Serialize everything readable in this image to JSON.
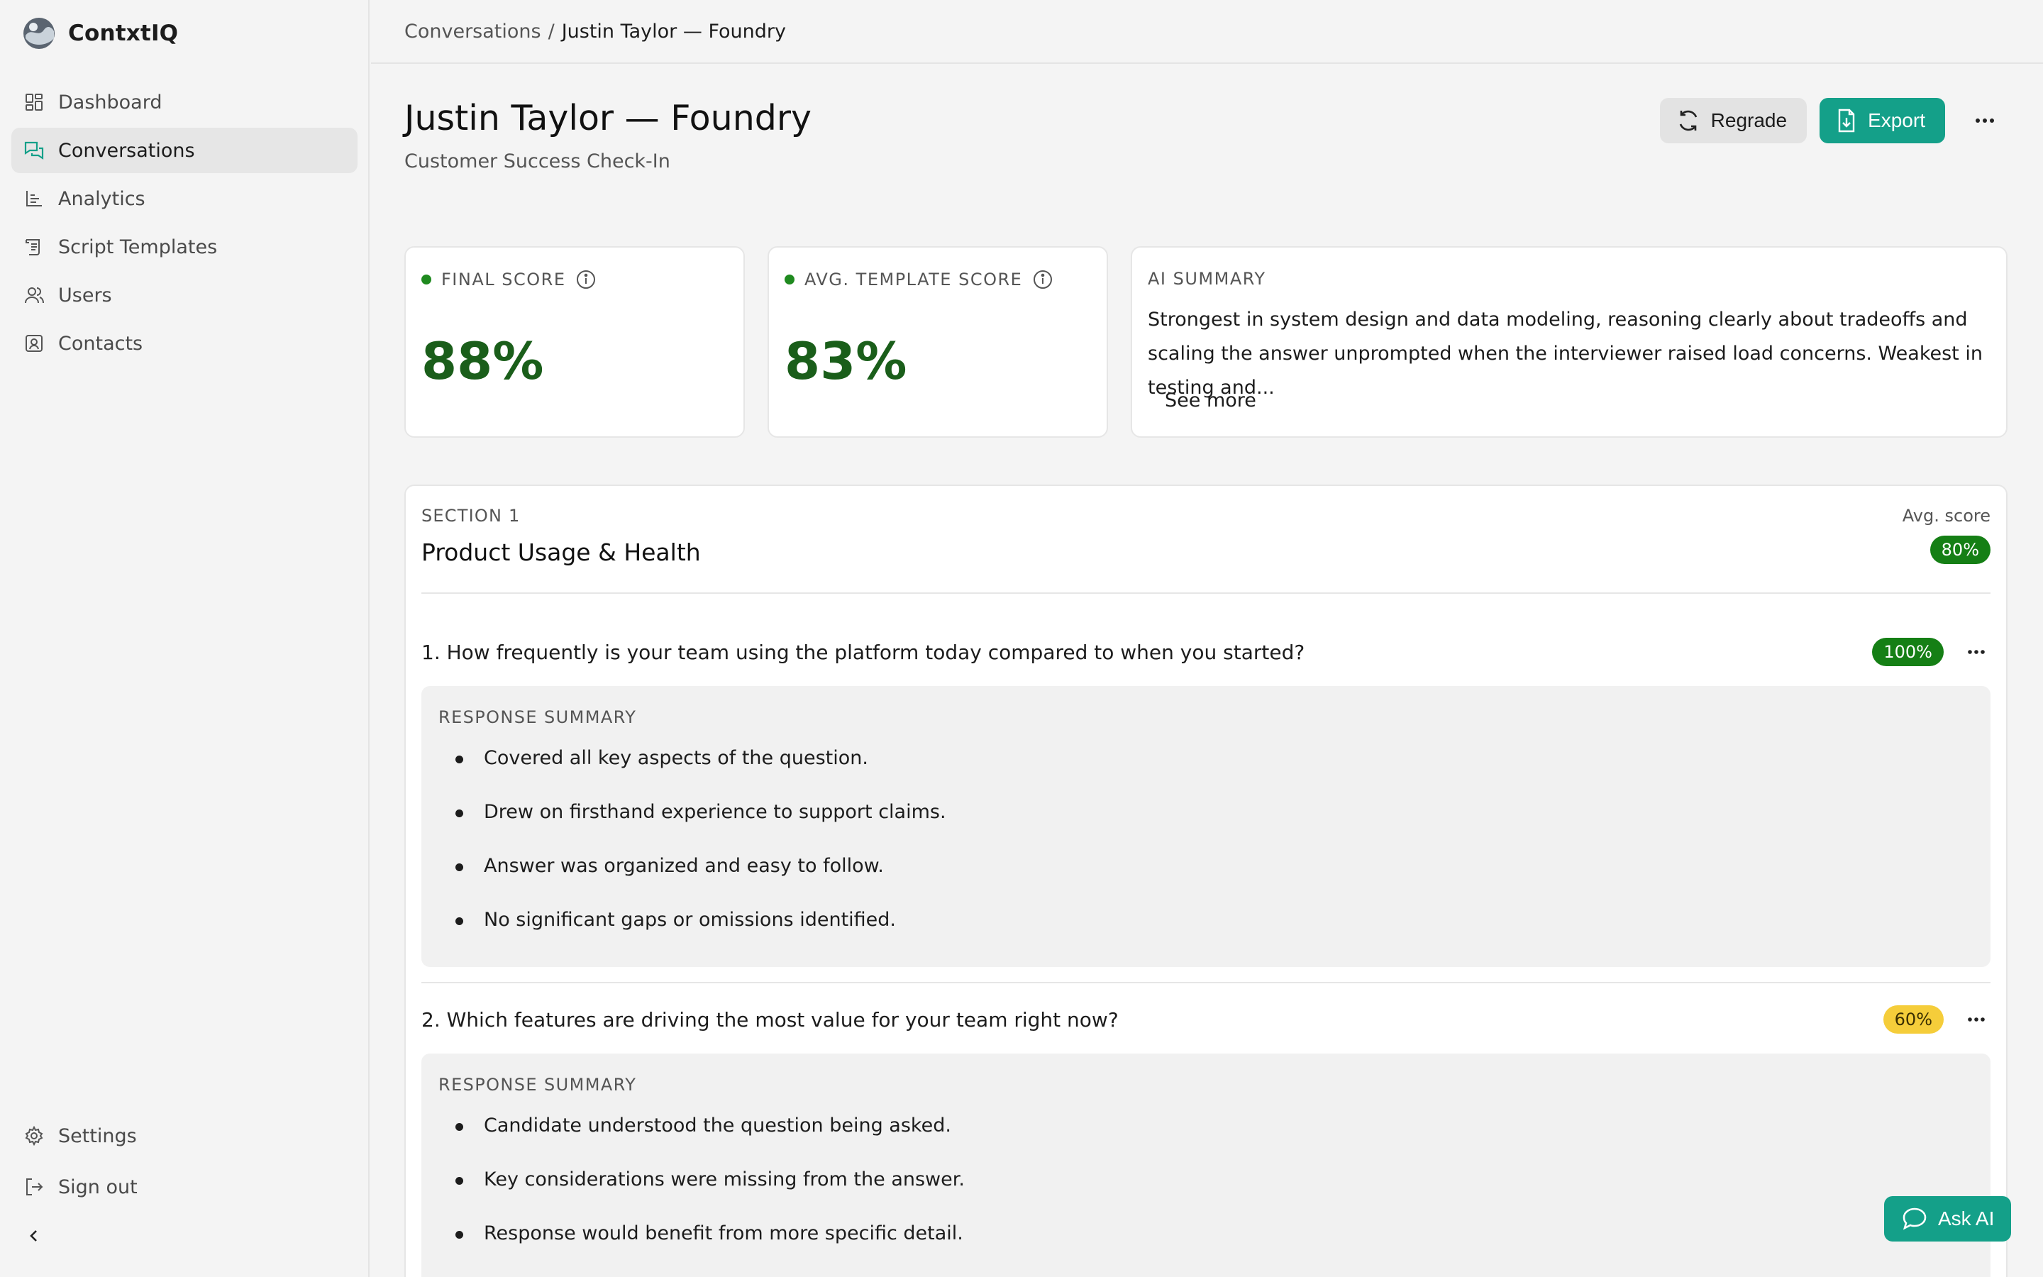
{
  "app": {
    "name": "ContxtIQ"
  },
  "sidebar": {
    "items": [
      {
        "label": "Dashboard",
        "icon": "dashboard-icon"
      },
      {
        "label": "Conversations",
        "icon": "chat-icon",
        "active": true
      },
      {
        "label": "Analytics",
        "icon": "chart-icon"
      },
      {
        "label": "Script Templates",
        "icon": "script-icon"
      },
      {
        "label": "Users",
        "icon": "users-icon"
      },
      {
        "label": "Contacts",
        "icon": "contact-icon"
      }
    ],
    "bottom": [
      {
        "label": "Settings",
        "icon": "gear-icon"
      },
      {
        "label": "Sign out",
        "icon": "sign-out-icon"
      }
    ]
  },
  "breadcrumb": {
    "parent": "Conversations",
    "sep": "/",
    "current": "Justin Taylor — Foundry"
  },
  "header": {
    "title": "Justin Taylor — Foundry",
    "subtitle": "Customer Success Check-In",
    "regrade_label": "Regrade",
    "export_label": "Export"
  },
  "scores": {
    "final": {
      "label": "FINAL SCORE",
      "value": "88%"
    },
    "template": {
      "label": "AVG. TEMPLATE SCORE",
      "value": "83%"
    }
  },
  "ai_summary": {
    "label": "AI SUMMARY",
    "text": "Strongest in system design and data modeling, reasoning clearly about tradeoffs and scaling the answer unprompted when the interviewer raised load concerns. Weakest in testing and...",
    "see_more": "See more"
  },
  "section": {
    "kicker": "SECTION 1",
    "title": "Product Usage & Health",
    "avg_label": "Avg. score",
    "avg_value": "80%",
    "questions": [
      {
        "text": "1. How frequently is your team using the platform today compared to when you started?",
        "score": "100%",
        "summary_label": "RESPONSE SUMMARY",
        "bullets": [
          "Covered all key aspects of the question.",
          "Drew on firsthand experience to support claims.",
          "Answer was organized and easy to follow.",
          "No significant gaps or omissions identified."
        ]
      },
      {
        "text": "2. Which features are driving the most value for your team right now?",
        "score": "60%",
        "summary_label": "RESPONSE SUMMARY",
        "bullets": [
          "Candidate understood the question being asked.",
          "Key considerations were missing from the answer.",
          "Response would benefit from more specific detail."
        ]
      }
    ]
  },
  "ask_ai": {
    "label": "Ask AI"
  },
  "colors": {
    "accent": "#14a089",
    "score_green": "#1a5e1a",
    "badge_green": "#157f15",
    "badge_yellow": "#f5cd3a"
  }
}
